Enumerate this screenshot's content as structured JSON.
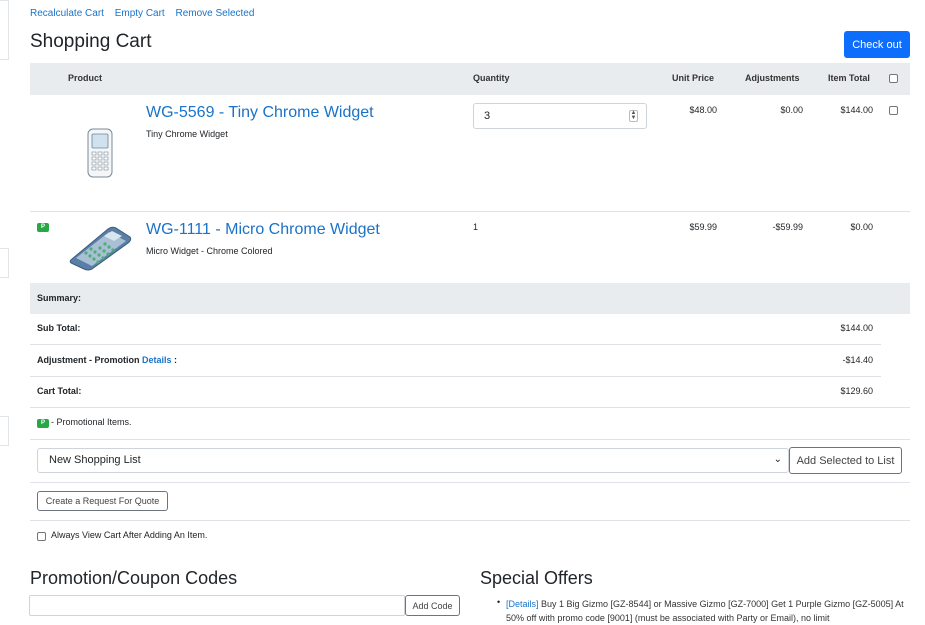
{
  "toolbar": {
    "recalculate": "Recalculate Cart",
    "empty": "Empty Cart",
    "remove": "Remove Selected"
  },
  "page_title": "Shopping Cart",
  "checkout_label": "Check out",
  "table": {
    "headers": {
      "product": "Product",
      "quantity": "Quantity",
      "unit_price": "Unit Price",
      "adjustments": "Adjustments",
      "item_total": "Item Total"
    },
    "rows": [
      {
        "name": "WG-5569 - Tiny Chrome Widget",
        "description": "Tiny Chrome Widget",
        "quantity": "3",
        "unit_price": "$48.00",
        "adjustments": "$0.00",
        "item_total": "$144.00",
        "image": "mobile-phone-icon",
        "promo": false
      },
      {
        "name": "WG-1111 - Micro Chrome Widget",
        "description": "Micro Widget - Chrome Colored",
        "quantity": "1",
        "unit_price": "$59.99",
        "adjustments": "-$59.99",
        "item_total": "$0.00",
        "image": "calculator-icon",
        "promo": true,
        "promo_badge": "P"
      }
    ]
  },
  "summary": {
    "heading": "Summary:",
    "sub_total_label": "Sub Total:",
    "sub_total": "$144.00",
    "adjustment_label": "Adjustment - Promotion",
    "adjustment_link": "Details",
    "adjustment_colon": ":",
    "adjustment_value": "-$14.40",
    "cart_total_label": "Cart Total:",
    "cart_total": "$129.60"
  },
  "promo_note": {
    "badge": "P",
    "text": "- Promotional Items."
  },
  "shopping_list": {
    "selected": "New Shopping List",
    "add_label": "Add Selected to List"
  },
  "quote_label": "Create a Request For Quote",
  "always_view_label": "Always View Cart After Adding An Item.",
  "promo_codes": {
    "heading": "Promotion/Coupon Codes",
    "add_label": "Add Code",
    "input_value": ""
  },
  "special_offers": {
    "heading": "Special Offers",
    "items": [
      {
        "link": "[Details]",
        "text": "Buy 1 Big Gizmo [GZ-8544] or Massive Gizmo [GZ-7000] Get 1 Purple Gizmo [GZ-5005] At 50% off with promo code [9001] (must be associated with Party or Email), no limit"
      }
    ]
  },
  "colors": {
    "primary": "#0d6efd",
    "link": "#1a73c8",
    "header_bg": "#e9ecef",
    "promo_badge": "#28a745"
  }
}
